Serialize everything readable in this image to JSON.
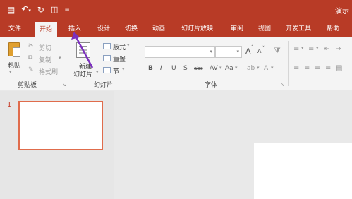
{
  "title_bar": {
    "quick_access": {
      "save_icon": "save-icon",
      "undo_icon": "undo-icon",
      "redo_icon": "redo-icon",
      "start_from_beginning_icon": "start-from-beginning-icon",
      "customize_icon": "customize-qat-icon"
    },
    "doc_title_partial": "演示"
  },
  "tabs": [
    {
      "label": "文件"
    },
    {
      "label": "开始",
      "active": true
    },
    {
      "label": "插入"
    },
    {
      "label": "设计"
    },
    {
      "label": "切换"
    },
    {
      "label": "动画"
    },
    {
      "label": "幻灯片放映"
    },
    {
      "label": "审阅"
    },
    {
      "label": "视图"
    },
    {
      "label": "开发工具"
    },
    {
      "label": "帮助"
    }
  ],
  "ribbon": {
    "clipboard": {
      "paste": "粘贴",
      "cut": "剪切",
      "copy": "复制",
      "format_painter": "格式刷",
      "group_label": "剪贴板"
    },
    "slides": {
      "new_slide_line1": "新建",
      "new_slide_line2": "幻灯片",
      "layout": "版式",
      "reset": "重置",
      "section": "节",
      "group_label": "幻灯片"
    },
    "font": {
      "font_name_value": "",
      "font_size_value": "",
      "grow": "A",
      "shrink": "A",
      "bold": "B",
      "italic": "I",
      "underline": "U",
      "strike": "S",
      "shadow": "abc",
      "spacing": "AV",
      "case": "Aa",
      "highlight": "ab",
      "color": "A",
      "group_label": "字体"
    }
  },
  "slides_pane": {
    "slides": [
      {
        "number": "1"
      }
    ]
  },
  "accent_color": "#b83b26",
  "annotation_arrow_color": "#7b2fbe"
}
